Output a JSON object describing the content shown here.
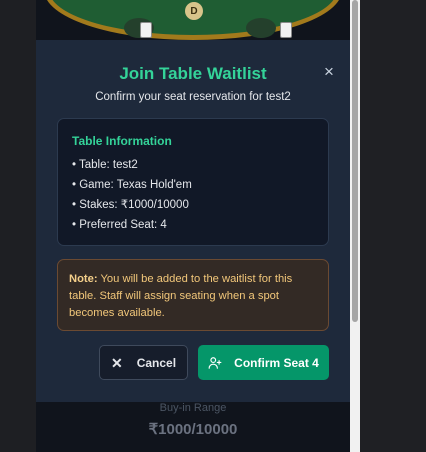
{
  "background_table": {
    "dealer_label": "D",
    "buyin_label": "Buy-in Range",
    "buyin_value": "₹1000/10000"
  },
  "modal": {
    "title": "Join Table Waitlist",
    "subtitle": "Confirm your seat reservation for test2",
    "close_icon": "close-icon",
    "info": {
      "heading": "Table Information",
      "items": [
        "• Table: test2",
        "• Game: Texas Hold'em",
        "• Stakes: ₹1000/10000",
        "• Preferred Seat: 4"
      ]
    },
    "note": {
      "label": "Note:",
      "text": " You will be added to the waitlist for this table. Staff will assign seating when a spot becomes available."
    },
    "buttons": {
      "cancel": "Cancel",
      "cancel_icon": "close-icon",
      "confirm": "Confirm Seat 4",
      "confirm_icon": "user-plus-icon"
    }
  },
  "colors": {
    "accent": "#34d399",
    "confirm_bg": "#059669",
    "modal_bg": "#1e293b",
    "note_text": "#f2c77a"
  }
}
